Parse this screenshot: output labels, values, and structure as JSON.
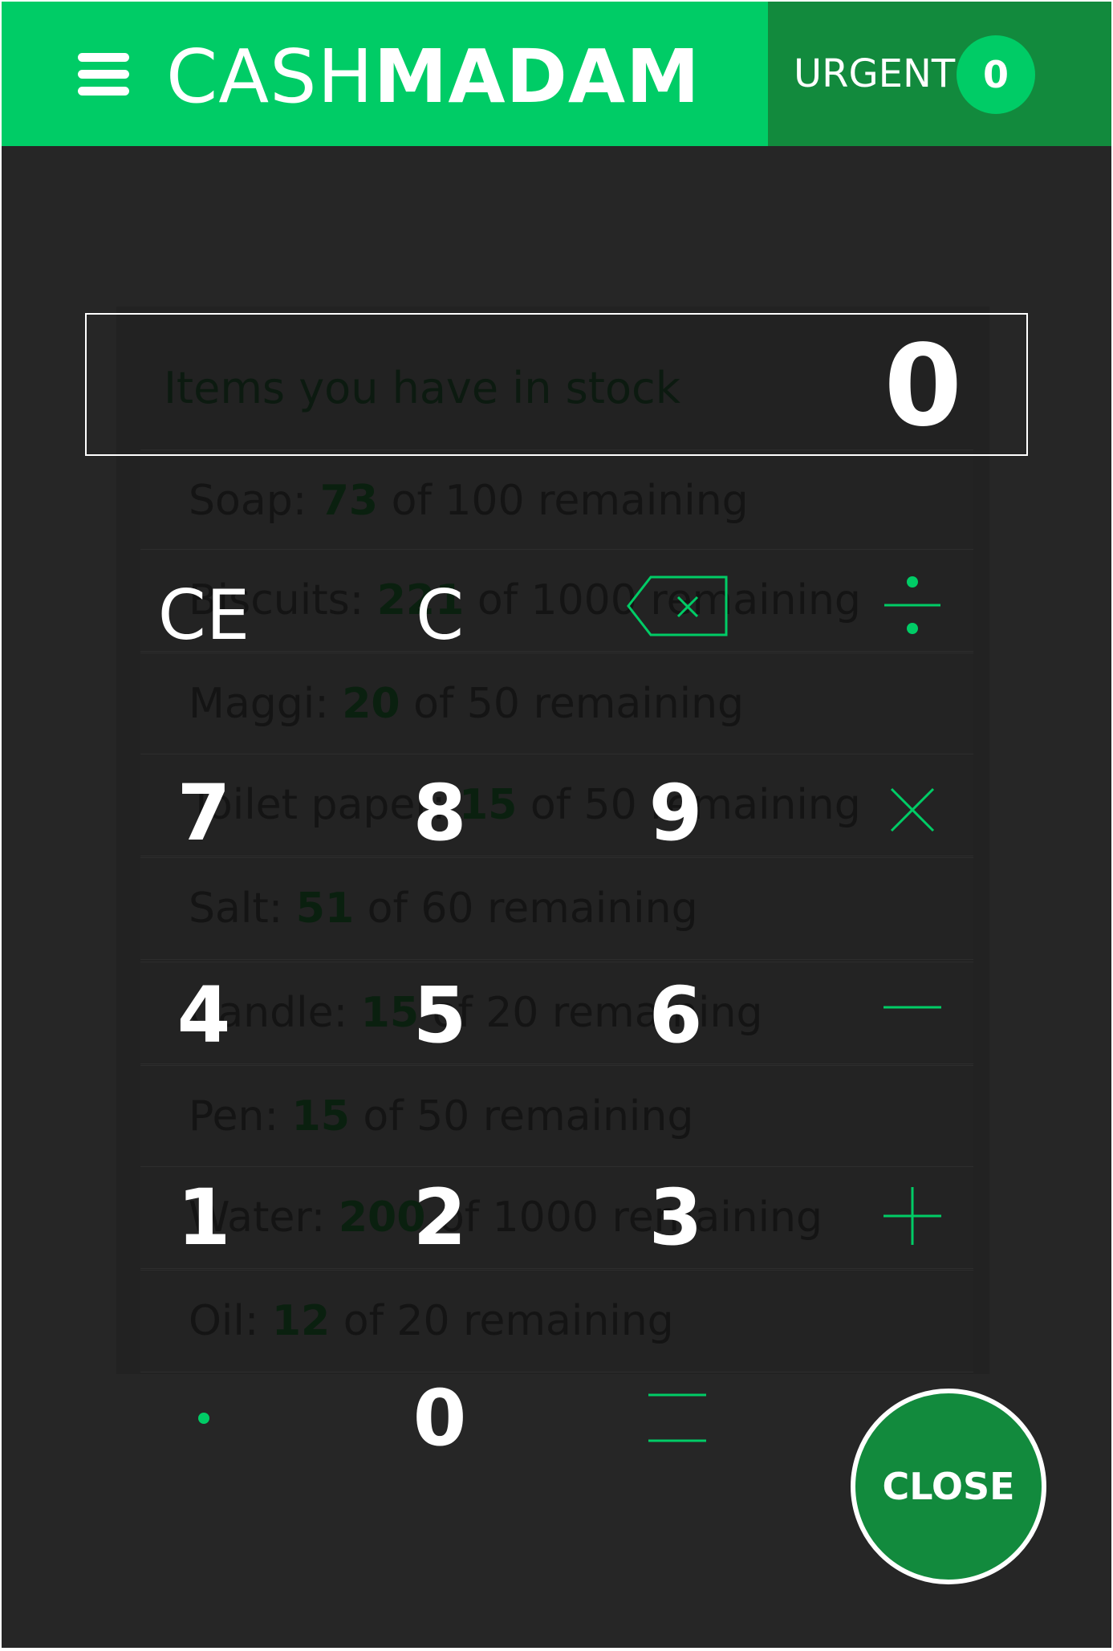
{
  "header": {
    "brand_light": "CASH",
    "brand_bold": "MADAM",
    "urgent_label": "URGENT",
    "urgent_count": "0"
  },
  "display": {
    "label": "Items you have in stock",
    "value": "0"
  },
  "stock": [
    {
      "name": "Soap:",
      "qty": "73",
      "rest": "of 100 remaining"
    },
    {
      "name": "Biscuits:",
      "qty": "221",
      "rest": "of 1000 remaining"
    },
    {
      "name": "Maggi:",
      "qty": "20",
      "rest": "of 50 remaining"
    },
    {
      "name": "Toilet paper:",
      "qty": "15",
      "rest": "of 50 remaining"
    },
    {
      "name": "Salt:",
      "qty": "51",
      "rest": "of 60 remaining"
    },
    {
      "name": "Candle:",
      "qty": "15",
      "rest": "of 20 remaining"
    },
    {
      "name": "Pen:",
      "qty": "15",
      "rest": "of 50 remaining"
    },
    {
      "name": "Water:",
      "qty": "200",
      "rest": "of 1000 remaining"
    },
    {
      "name": "Oil:",
      "qty": "12",
      "rest": "of 20 remaining"
    }
  ],
  "keypad": {
    "ce": "CE",
    "c": "C",
    "k7": "7",
    "k8": "8",
    "k9": "9",
    "k4": "4",
    "k5": "5",
    "k6": "6",
    "k1": "1",
    "k2": "2",
    "k3": "3",
    "k0": "0",
    "icons": {
      "backspace": "backspace-icon",
      "divide": "divide-icon",
      "multiply": "multiply-icon",
      "subtract": "minus-icon",
      "add": "plus-icon",
      "decimal": "decimal-point-icon",
      "equals": "equals-icon"
    }
  },
  "close_label": "CLOSE",
  "colors": {
    "accent": "#00cc66",
    "dark_accent": "#128a3d",
    "background": "#262626"
  }
}
